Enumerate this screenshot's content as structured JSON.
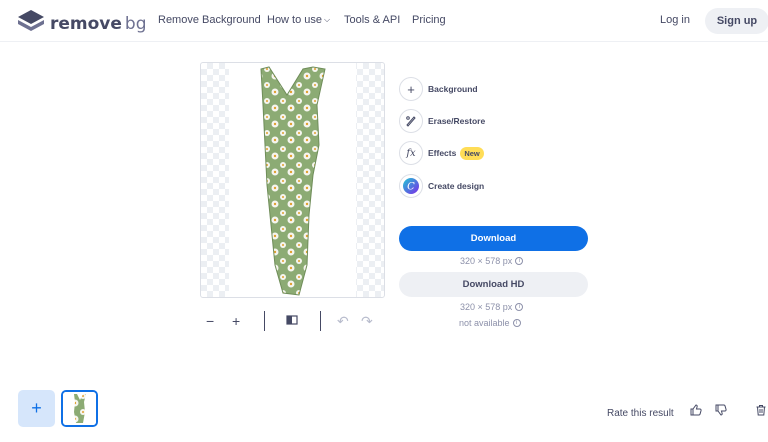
{
  "header": {
    "logo_text": "remove",
    "logo_suffix": "bg",
    "nav": [
      "Remove Background",
      "How to use",
      "Tools & API",
      "Pricing"
    ],
    "login": "Log in",
    "signup": "Sign up"
  },
  "tools": {
    "background": "Background",
    "erase_restore": "Erase/Restore",
    "effects": "Effects",
    "effects_badge": "New",
    "create_design": "Create design"
  },
  "download": {
    "label": "Download",
    "size": "320 × 578 px",
    "hd_label": "Download HD",
    "hd_size": "320 × 578 px",
    "hd_status": "not available"
  },
  "footer": {
    "rate_text": "Rate this result"
  },
  "icons": [
    "removebg-logo-icon",
    "chevron-down-icon",
    "plus-icon",
    "brush-icon",
    "fx-icon",
    "canva-icon",
    "zoom-out-icon",
    "zoom-in-icon",
    "compare-icon",
    "undo-icon",
    "redo-icon",
    "info-icon",
    "thumbs-up-icon",
    "thumbs-down-icon",
    "trash-icon"
  ],
  "colors": {
    "accent": "#0f70e6",
    "badge": "#ffdd57",
    "text": "#454964"
  }
}
